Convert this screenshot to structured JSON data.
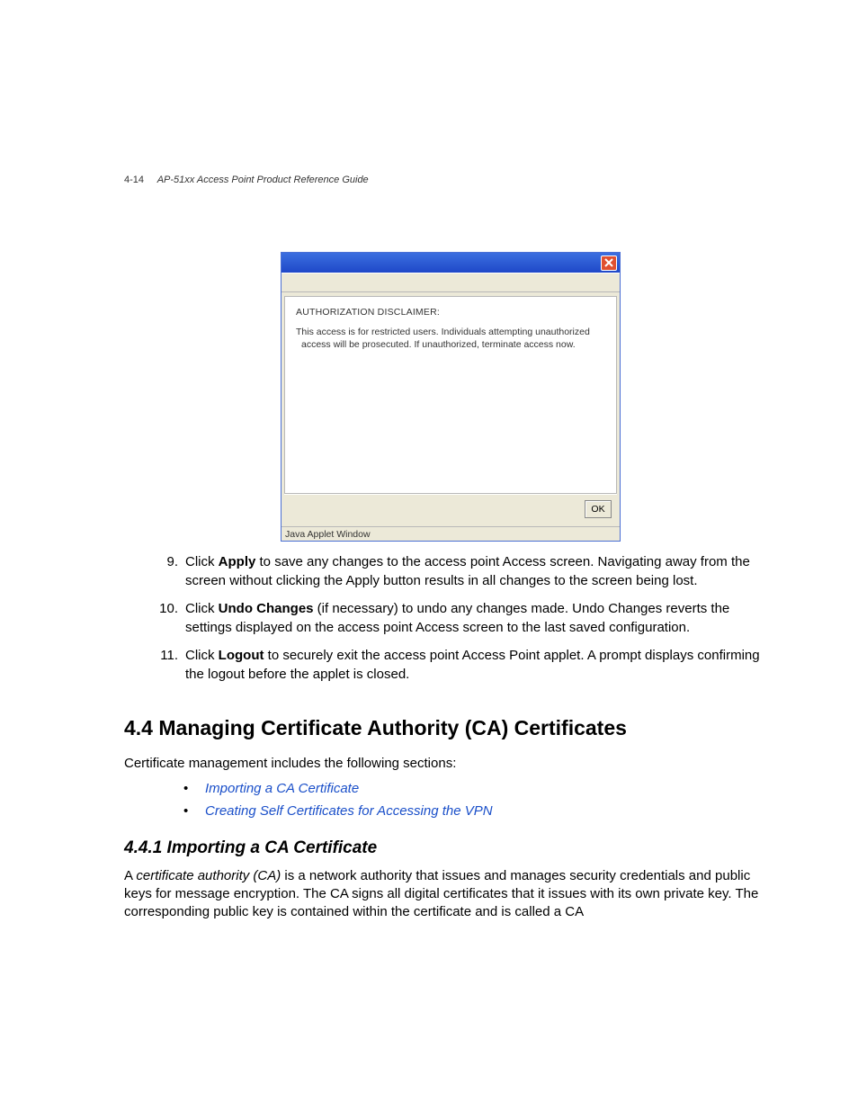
{
  "header": {
    "page_number": "4-14",
    "guide_title": "AP-51xx Access Point Product Reference Guide"
  },
  "dialog": {
    "disclaimer_title": "AUTHORIZATION DISCLAIMER:",
    "disclaimer_line1": "This access is for restricted users. Individuals attempting unauthorized",
    "disclaimer_line2": "access will be prosecuted.  If unauthorized, terminate access now.",
    "ok_label": "OK",
    "status_text": "Java Applet Window"
  },
  "steps": [
    {
      "n": "9.",
      "lead": "Click ",
      "bold": "Apply",
      "rest": " to save any changes to the access point Access screen. Navigating away from the screen without clicking the Apply button results in all changes to the screen being lost."
    },
    {
      "n": "10.",
      "lead": "Click ",
      "bold": "Undo Changes",
      "rest": " (if necessary) to undo any changes made. Undo Changes reverts the settings displayed on the access point Access screen to the last saved configuration."
    },
    {
      "n": "11.",
      "lead": "Click ",
      "bold": "Logout",
      "rest": " to securely exit the access point Access Point applet. A prompt displays confirming the logout before the applet is closed."
    }
  ],
  "section": {
    "heading": "4.4 Managing Certificate Authority (CA) Certificates",
    "intro": "Certificate management includes the following sections:",
    "links": [
      "Importing a CA Certificate",
      "Creating Self Certificates for Accessing the VPN"
    ]
  },
  "subsection": {
    "heading": "4.4.1 Importing a CA Certificate",
    "para_lead": "A ",
    "para_ital": "certificate authority (CA)",
    "para_rest": " is a network authority that issues and manages security credentials and public keys for message encryption. The CA signs all digital certificates that it issues with its own private key. The corresponding public key is contained within the certificate and is called a CA"
  }
}
